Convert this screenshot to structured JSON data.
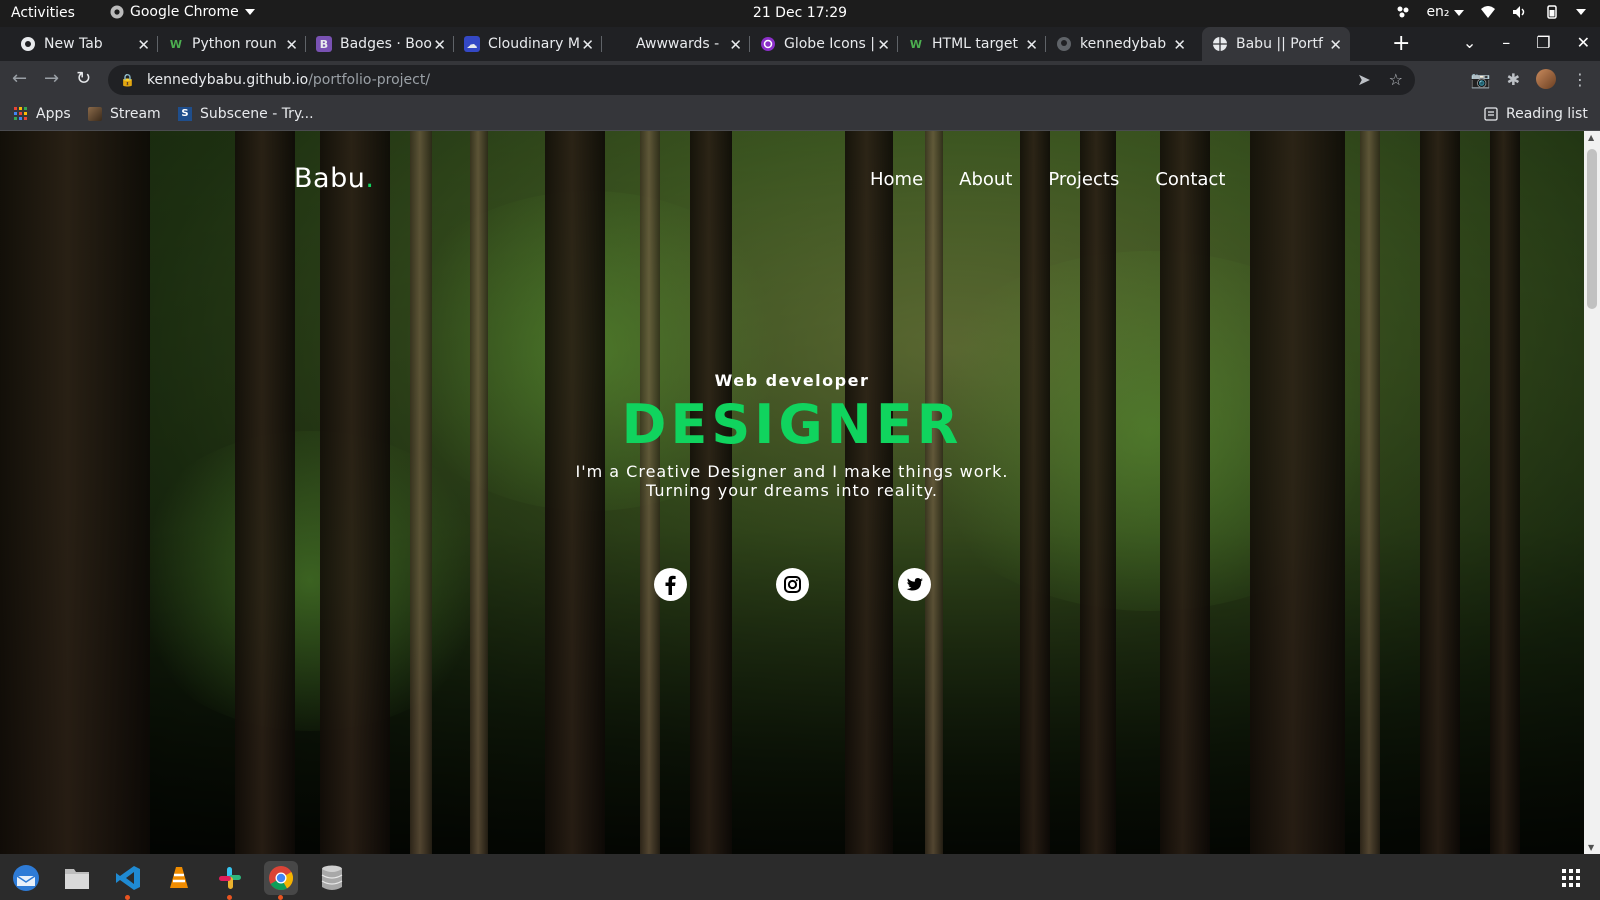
{
  "system_bar": {
    "activities": "Activities",
    "app_name": "Google Chrome",
    "datetime": "21 Dec  17:29",
    "language": "en₂"
  },
  "tabs": [
    {
      "title": "New Tab",
      "favicon": "chrome-icon"
    },
    {
      "title": "Python roun",
      "favicon": "w-icon"
    },
    {
      "title": "Badges · Boo",
      "favicon": "bootstrap-icon"
    },
    {
      "title": "Cloudinary M",
      "favicon": "cloudinary-icon"
    },
    {
      "title": "Awwwards -",
      "favicon": "awwwards-icon"
    },
    {
      "title": "Globe Icons |",
      "favicon": "globe-icon"
    },
    {
      "title": "HTML target",
      "favicon": "w-icon"
    },
    {
      "title": "kennedybab",
      "favicon": "github-icon"
    },
    {
      "title": "Babu || Portf",
      "favicon": "globe-icon",
      "active": true
    }
  ],
  "toolbar": {
    "url_host": "kennedybabu.github.io",
    "url_path": "/portfolio-project/"
  },
  "bookmarks": {
    "apps": "Apps",
    "stream": "Stream",
    "subscene": "Subscene - Try...",
    "reading_list": "Reading list"
  },
  "site": {
    "logo_text": "Babu",
    "logo_dot": ".",
    "nav": [
      "Home",
      "About",
      "Projects",
      "Contact"
    ],
    "hero": {
      "eyebrow": "Web developer",
      "headline": "DESIGNER",
      "tagline_1": "I'm a Creative Designer and I make things work.",
      "tagline_2": "Turning your dreams into reality."
    },
    "socials": [
      "facebook-icon",
      "instagram-icon",
      "twitter-icon"
    ],
    "accent_color": "#10d45e"
  },
  "dock": [
    "thunderbird-icon",
    "files-icon",
    "vscode-icon",
    "vlc-icon",
    "slack-icon",
    "chrome-icon",
    "database-icon"
  ]
}
